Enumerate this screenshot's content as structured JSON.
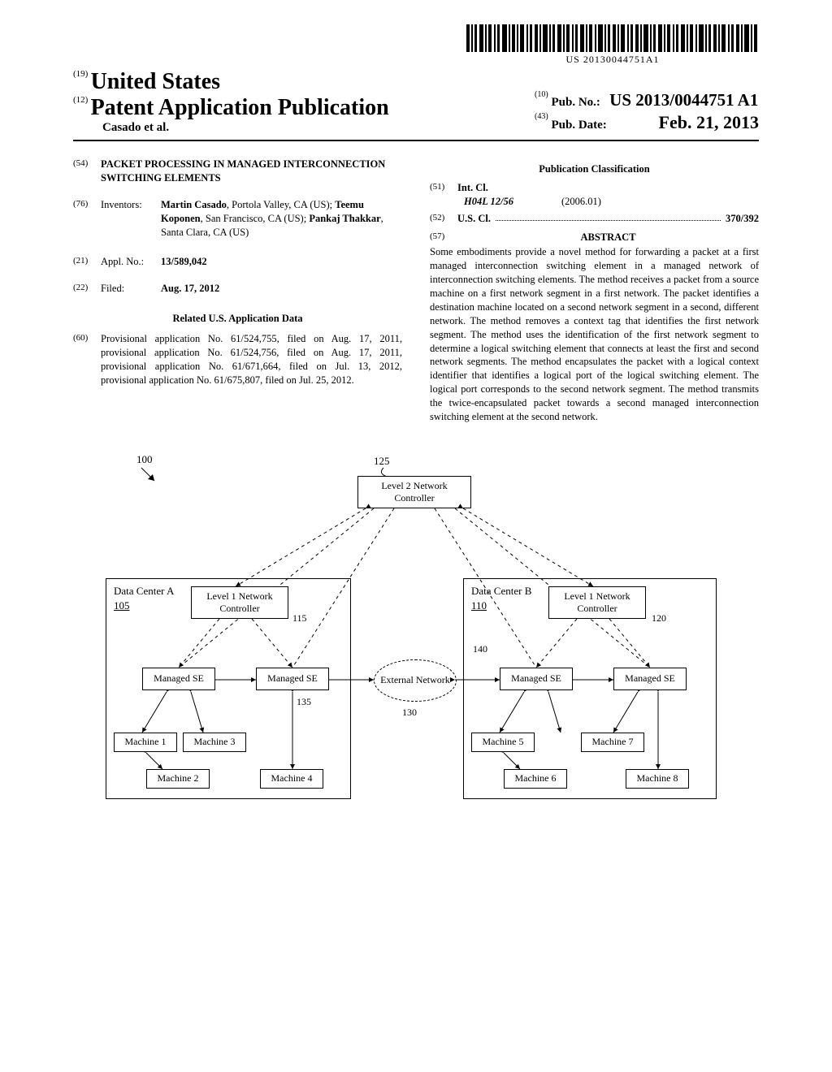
{
  "barcode_text": "US 20130044751A1",
  "header": {
    "code19": "(19)",
    "country": "United States",
    "code12": "(12)",
    "pub_type": "Patent Application Publication",
    "authors": "Casado et al.",
    "code10": "(10)",
    "pub_no_label": "Pub. No.:",
    "pub_no": "US 2013/0044751 A1",
    "code43": "(43)",
    "pub_date_label": "Pub. Date:",
    "pub_date": "Feb. 21, 2013"
  },
  "left": {
    "code54": "(54)",
    "title": "PACKET PROCESSING IN MANAGED INTERCONNECTION SWITCHING ELEMENTS",
    "code76": "(76)",
    "inventors_label": "Inventors:",
    "inventors": "Martin Casado, Portola Valley, CA (US); Teemu Koponen, San Francisco, CA (US); Pankaj Thakkar, Santa Clara, CA (US)",
    "inventors_bold": [
      "Martin Casado",
      "Teemu Koponen",
      "Pankaj Thakkar"
    ],
    "inventors_plain": [
      ", Portola Valley, CA (US); ",
      ", San Francisco, CA (US); ",
      ", Santa Clara, CA (US)"
    ],
    "code21": "(21)",
    "appl_label": "Appl. No.:",
    "appl_no": "13/589,042",
    "code22": "(22)",
    "filed_label": "Filed:",
    "filed": "Aug. 17, 2012",
    "related_hdr": "Related U.S. Application Data",
    "code60": "(60)",
    "provisional": "Provisional application No. 61/524,755, filed on Aug. 17, 2011, provisional application No. 61/524,756, filed on Aug. 17, 2011, provisional application No. 61/671,664, filed on Jul. 13, 2012, provisional application No. 61/675,807, filed on Jul. 25, 2012."
  },
  "right": {
    "section_hdr": "Publication Classification",
    "code51": "(51)",
    "int_cl_label": "Int. Cl.",
    "int_cl_code": "H04L 12/56",
    "int_cl_year": "(2006.01)",
    "code52": "(52)",
    "us_cl_label": "U.S. Cl.",
    "us_cl_value": "370/392",
    "code57": "(57)",
    "abstract_label": "ABSTRACT",
    "abstract": "Some embodiments provide a novel method for forwarding a packet at a first managed interconnection switching element in a managed network of interconnection switching elements. The method receives a packet from a source machine on a first network segment in a first network. The packet identifies a destination machine located on a second network segment in a second, different network. The method removes a context tag that identifies the first network segment. The method uses the identification of the first network segment to determine a logical switching element that connects at least the first and second network segments. The method encapsulates the packet with a logical context identifier that identifies a logical port of the logical switching element. The logical port corresponds to the second network segment. The method transmits the twice-encapsulated packet towards a second managed interconnection switching element at the second network."
  },
  "figure": {
    "ref100": "100",
    "ref125": "125",
    "ref105": "105",
    "ref110": "110",
    "ref115": "115",
    "ref120": "120",
    "ref130": "130",
    "ref135": "135",
    "ref140": "140",
    "l2nc": "Level 2 Network Controller",
    "dcA": "Data Center A",
    "dcB": "Data Center B",
    "l1nc": "Level 1 Network Controller",
    "mse": "Managed SE",
    "ext": "External Network",
    "m1": "Machine 1",
    "m2": "Machine 2",
    "m3": "Machine 3",
    "m4": "Machine 4",
    "m5": "Machine 5",
    "m6": "Machine 6",
    "m7": "Machine 7",
    "m8": "Machine 8"
  }
}
